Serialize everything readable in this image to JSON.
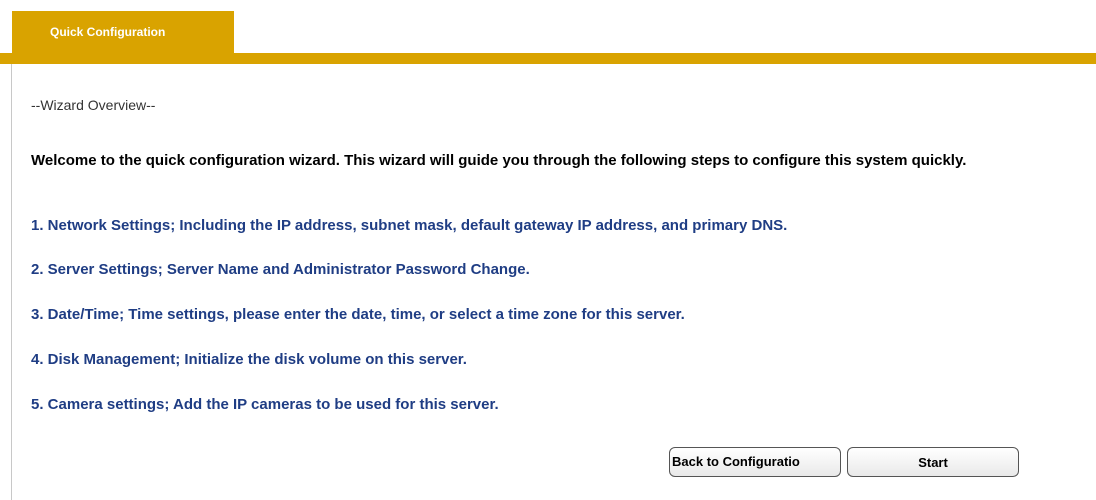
{
  "tab": {
    "label": "Quick Configuration"
  },
  "wizard": {
    "overview_title": "--Wizard Overview--",
    "welcome": "Welcome to the quick configuration wizard. This wizard will guide you through the following steps to configure this system quickly.",
    "steps": [
      "1. Network Settings; Including the IP address, subnet mask, default gateway IP address, and primary DNS.",
      "2. Server Settings; Server Name and Administrator Password Change.",
      "3. Date/Time; Time settings, please enter the date, time, or select a time zone for this server.",
      "4. Disk Management; Initialize the disk volume on this server.",
      "5. Camera settings; Add the IP cameras to be used for this server."
    ]
  },
  "buttons": {
    "back_label": "Back to Configuratio",
    "start_label": "Start"
  },
  "colors": {
    "accent": "#d9a300",
    "step_text": "#1f3d84"
  }
}
